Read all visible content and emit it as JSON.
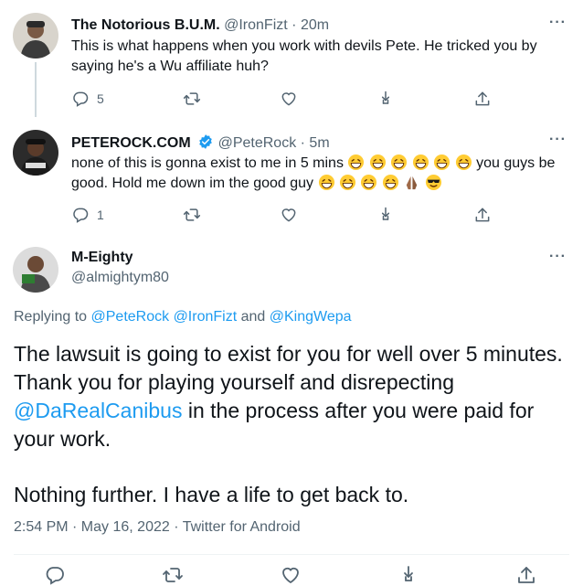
{
  "tweets": [
    {
      "name": "The Notorious B.U.M.",
      "handle": "@IronFizt",
      "sep": "·",
      "time": "20m",
      "text": "This is what happens when you work with devils Pete. He tricked you by saying he's a Wu affiliate huh?",
      "reply_count": "5"
    },
    {
      "name": "PETEROCK.COM",
      "handle": "@PeteRock",
      "sep": "·",
      "time": "5m",
      "text_a": "none of this is gonna exist to me in 5 mins",
      "text_b": "you guys be good. Hold me down im the good guy",
      "reply_count": "1"
    }
  ],
  "main": {
    "name": "M-Eighty",
    "handle": "@almightym80",
    "replying_prefix": "Replying to",
    "replying_user1": "@PeteRock",
    "replying_user2": "@IronFizt",
    "replying_and": "and",
    "replying_user3": "@KingWepa",
    "text_1": "The lawsuit is going to exist for you for well over 5 minutes. Thank you for playing yourself and disrepecting",
    "mention": "@DaRealCanibus",
    "text_2": "in the process after you were paid for your work.",
    "text_3": "Nothing further. I have a life to get back to.",
    "meta": "2:54 PM · May 16, 2022 · Twitter for Android"
  },
  "more_label": "···",
  "colors": {
    "accent": "#1d9bf0",
    "muted": "#536471",
    "text": "#0f1419"
  },
  "icons": [
    "reply-icon",
    "retweet-icon",
    "like-icon",
    "share-icon",
    "upload-icon",
    "verified-icon",
    "grin-emoji",
    "pray-emoji",
    "sunglasses-emoji"
  ]
}
